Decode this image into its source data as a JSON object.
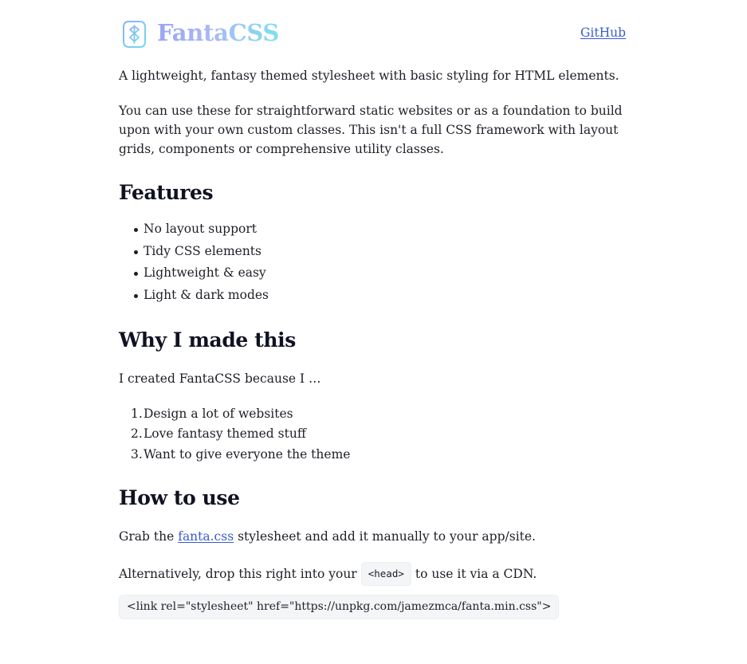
{
  "header": {
    "logo_icon": "rune-shield-icon",
    "logo_text": "FantaCSS",
    "github_label": "GitHub"
  },
  "intro": "A lightweight, fantasy themed stylesheet with basic styling for HTML elements.",
  "description": "You can use these for straightforward static websites or as a foundation to build upon with your own custom classes. This isn't a full CSS framework with layout grids, components or comprehensive utility classes.",
  "features": {
    "heading": "Features",
    "items": [
      "No layout support",
      "Tidy CSS elements",
      "Lightweight & easy",
      "Light & dark modes"
    ]
  },
  "why": {
    "heading": "Why I made this",
    "lead": "I created FantaCSS because I …",
    "items": [
      {
        "num": "1.",
        "text": "Design a lot of websites"
      },
      {
        "num": "2.",
        "text": "Love fantasy themed stuff"
      },
      {
        "num": "3.",
        "text": "Want to give everyone the theme"
      }
    ]
  },
  "how": {
    "heading": "How to use",
    "p1_before": "Grab the ",
    "p1_link": "fanta.css",
    "p1_after": " stylesheet and add it manually to your app/site.",
    "p2_before": "Alternatively, drop this right into your",
    "p2_code": "<head>",
    "p2_after": "to use it via a CDN.",
    "code_block": "<link rel=\"stylesheet\" href=\"https://unpkg.com/jamezmca/fanta.min.css\">"
  },
  "colors": {
    "link": "#3a5bd0",
    "logo_gradient_start": "#9aa4f6",
    "logo_gradient_end": "#7fe0f0",
    "text": "#1d1f27",
    "code_bg": "#f4f5f7"
  }
}
